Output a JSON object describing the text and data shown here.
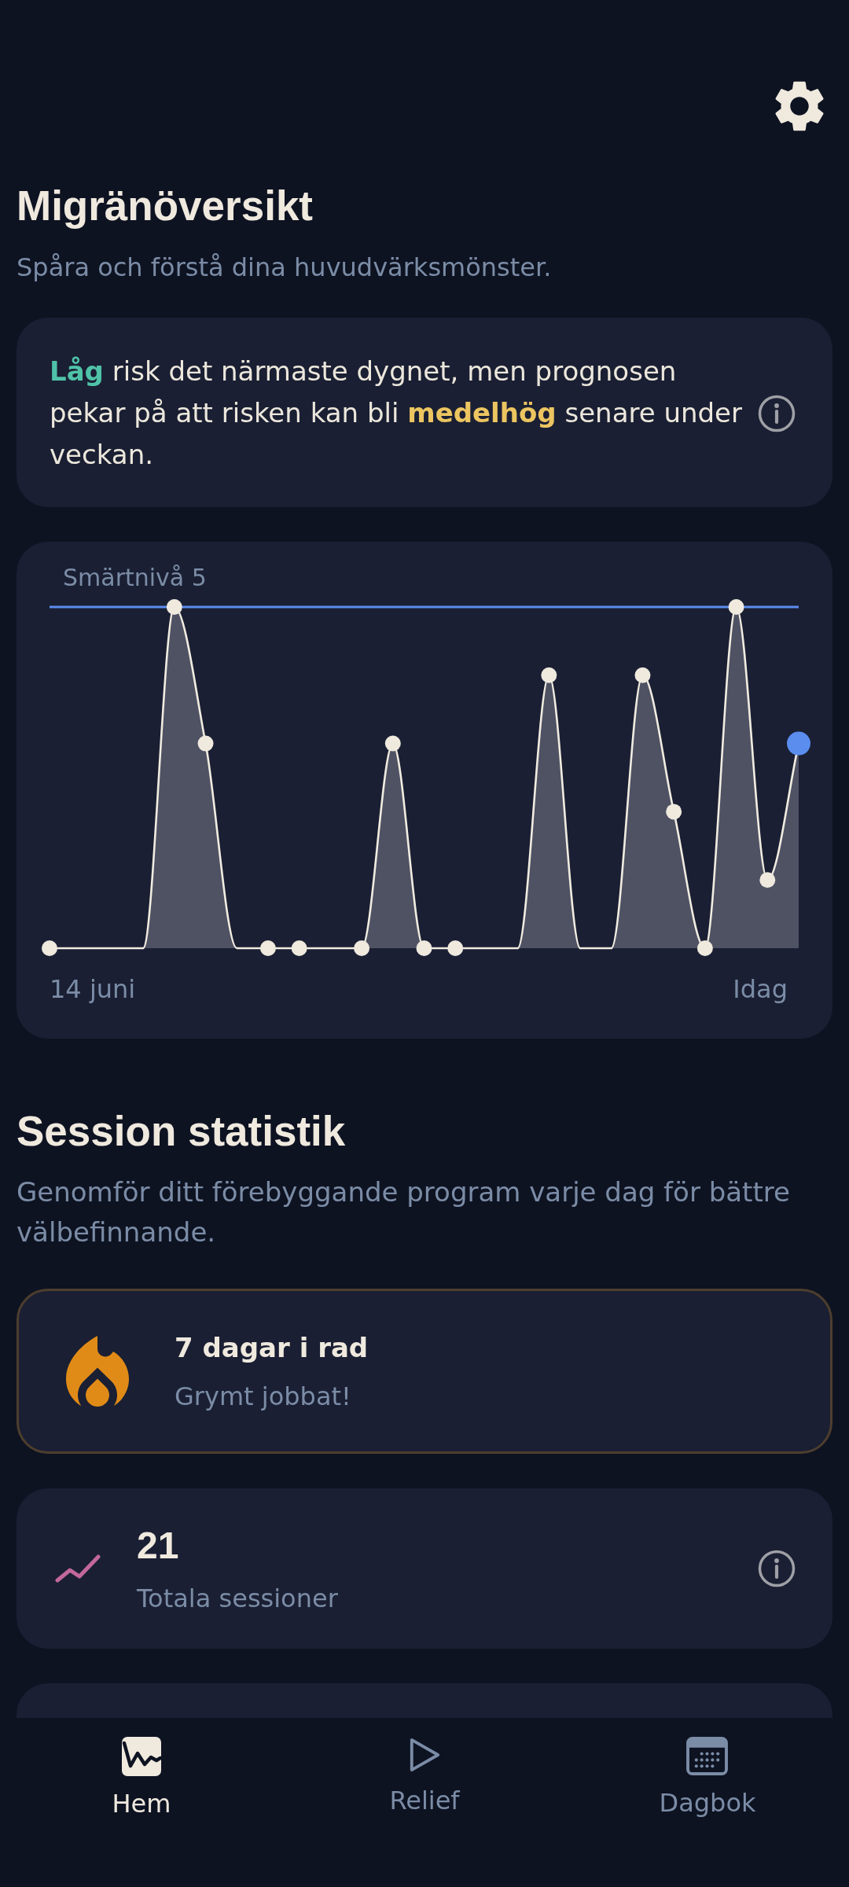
{
  "title": "Migränöversikt",
  "subtitle": "Spåra och förstå dina huvudvärksmönster.",
  "risk_card": {
    "message": [
      {
        "text": "**Låg**",
        "color": "#4fc2a8"
      },
      {
        "text": " risk det närmaste dygnet, men prognosen pekar på att risken kan bli "
      },
      {
        "text": "**medelhög**",
        "color": "#ecc561"
      },
      {
        "text": " senare under veckan."
      }
    ]
  },
  "pain_chart": {
    "reference_label": "Smärtnivå 5",
    "start_label": "14 juni",
    "end_label": "Idag"
  },
  "session_stats": {
    "title": "Session statistik",
    "subtitle": "Genomför ditt förebyggande program varje dag för bättre välbefinnande.",
    "cards": [
      {
        "kind": "streak",
        "title": "7 dagar i rad",
        "caption": "Grymt jobbat!"
      },
      {
        "kind": "total",
        "value": "21",
        "caption": "Totala sessioner"
      },
      {
        "kind": "partial"
      }
    ]
  },
  "bottom_nav": {
    "items": [
      {
        "label": "Hem",
        "selected": true
      },
      {
        "label": "Relief",
        "selected": false
      },
      {
        "label": "Dagbok",
        "selected": false
      }
    ]
  }
}
